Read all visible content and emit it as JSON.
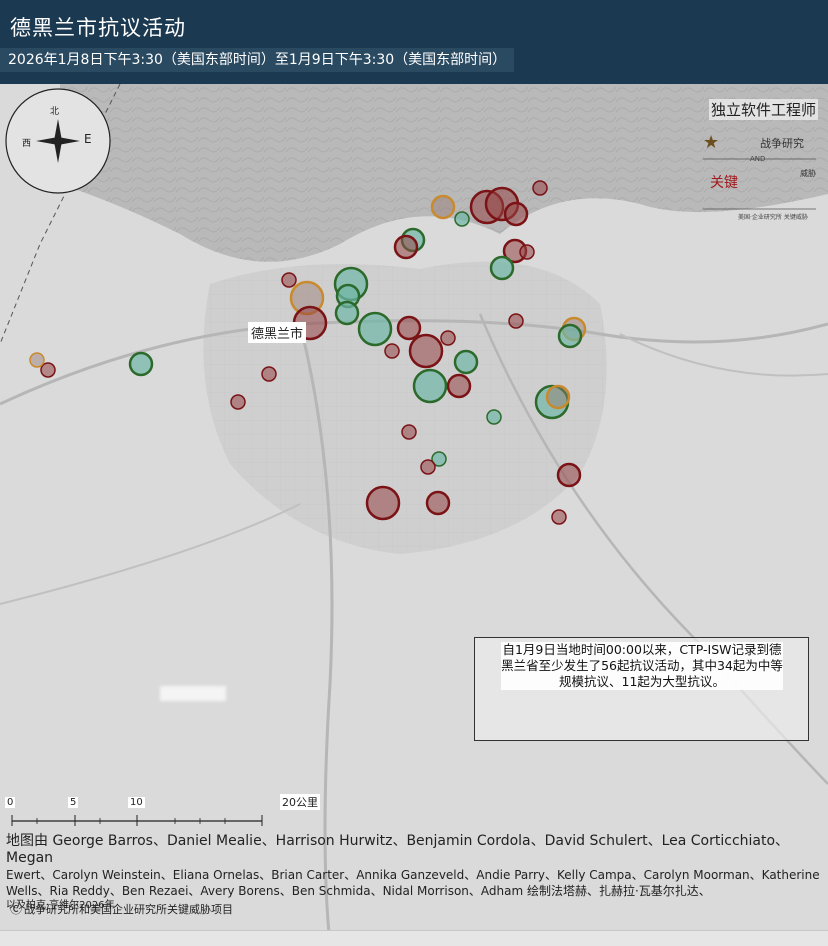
{
  "header": {
    "title": "德黑兰市抗议活动",
    "subtitle": "2026年1月8日下午3:30（美国东部时间）至1月9日下午3:30（美国东部时间）"
  },
  "map": {
    "city_label": "德黑兰市",
    "compass": {
      "north": "北",
      "east": "E",
      "west": "西"
    },
    "colors": {
      "red": "#7a1216",
      "green": "#2b6a2a",
      "orange": "#c98a2e",
      "teal_fill": "#6fb7a7"
    }
  },
  "logo": {
    "name": "独立软件工程师",
    "star": "★",
    "war_study": "战争研究",
    "and": "AND",
    "key": "关键",
    "threats": "威胁",
    "tagline": "美国·企业研究所 关键威胁"
  },
  "info_box": {
    "text": "自1月9日当地时间00:00以来，CTP-ISW记录到德黑兰省至少发生了56起抗议活动，其中34起为中等规模抗议、11起为大型抗议。"
  },
  "scale_bar": {
    "labels": [
      "0",
      "5",
      "10"
    ],
    "unit": "20公里"
  },
  "credits": {
    "line1": "地图由 George Barros、Daniel Mealie、Harrison Hurwitz、Benjamin Cordola、David Schulert、Lea Corticchiato、Megan",
    "line2": "Ewert、Carolyn Weinstein、Eliana Ornelas、Brian Carter、Annika Ganzeveld、Andie Parry、Kelly Campa、Carolyn Moorman、Katherine",
    "line3": "Wells、Ria Reddy、Ben Rezaei、Avery Borens、Ben Schmida、Nidal Morrison、Adham 绘制法塔赫、扎赫拉·瓦基尔扎达、",
    "line4": "以及柏克·亨维尔2026年",
    "copyright_symbol": "Ⓒ",
    "copyright": "战争研究所和美国企业研究所关键威胁项目"
  },
  "protests": [
    {
      "type": "large",
      "color": "red"
    },
    {
      "type": "large",
      "color": "red"
    },
    {
      "type": "medium",
      "color": "red"
    },
    {
      "type": "small",
      "color": "red"
    },
    {
      "type": "small",
      "color": "green"
    },
    {
      "type": "medium",
      "color": "orange"
    },
    {
      "type": "medium",
      "color": "green"
    },
    {
      "type": "medium",
      "color": "red"
    },
    {
      "type": "medium",
      "color": "red"
    },
    {
      "type": "medium",
      "color": "green"
    },
    {
      "type": "small",
      "color": "red"
    },
    {
      "type": "large",
      "color": "orange"
    },
    {
      "type": "large",
      "color": "green"
    },
    {
      "type": "medium",
      "color": "green"
    },
    {
      "type": "medium",
      "color": "green"
    },
    {
      "type": "large",
      "color": "red"
    },
    {
      "type": "large",
      "color": "green"
    },
    {
      "type": "medium",
      "color": "red"
    },
    {
      "type": "small",
      "color": "red"
    },
    {
      "type": "large",
      "color": "red"
    },
    {
      "type": "small",
      "color": "red"
    },
    {
      "type": "medium",
      "color": "green"
    },
    {
      "type": "medium",
      "color": "red"
    },
    {
      "type": "large",
      "color": "green"
    },
    {
      "type": "small",
      "color": "red"
    },
    {
      "type": "medium",
      "color": "orange"
    },
    {
      "type": "medium",
      "color": "green"
    },
    {
      "type": "medium",
      "color": "green"
    },
    {
      "type": "small",
      "color": "red"
    },
    {
      "type": "small",
      "color": "red"
    },
    {
      "type": "small",
      "color": "orange"
    },
    {
      "type": "small",
      "color": "red"
    },
    {
      "type": "large",
      "color": "green"
    },
    {
      "type": "medium",
      "color": "orange"
    },
    {
      "type": "small",
      "color": "green"
    },
    {
      "type": "small",
      "color": "red"
    },
    {
      "type": "small",
      "color": "green"
    },
    {
      "type": "small",
      "color": "red"
    },
    {
      "type": "medium",
      "color": "red"
    },
    {
      "type": "large",
      "color": "red"
    },
    {
      "type": "medium",
      "color": "red"
    },
    {
      "type": "small",
      "color": "red"
    },
    {
      "type": "small",
      "color": "red"
    }
  ]
}
